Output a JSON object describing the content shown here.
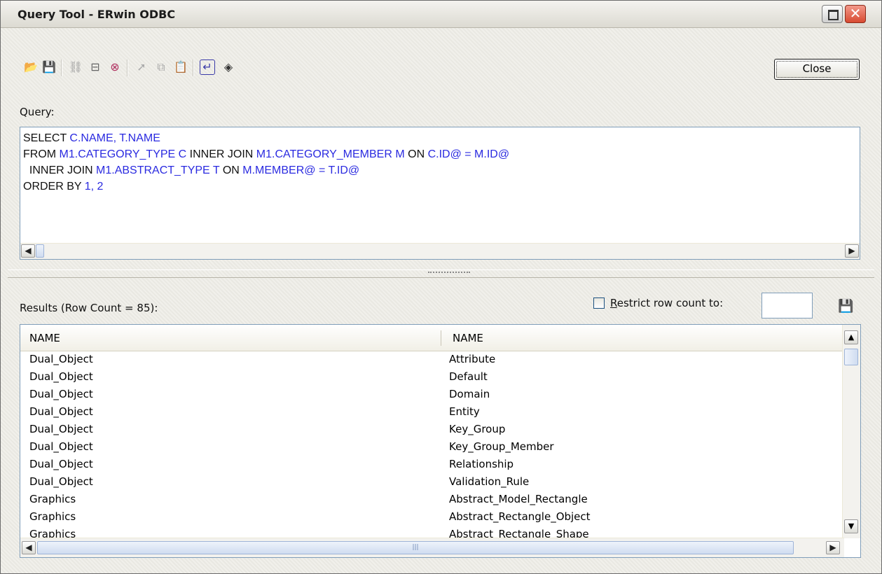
{
  "window": {
    "title": "Query Tool - ERwin ODBC"
  },
  "toolbar": {
    "close_label": "Close",
    "icons": [
      "open-icon",
      "save-icon",
      "link-icon",
      "tree-icon",
      "stop-icon",
      "run-icon",
      "copy-icon",
      "paste-icon",
      "enter-icon",
      "eraser-icon"
    ]
  },
  "query": {
    "label": "Query:",
    "lines": [
      [
        {
          "t": "SELECT ",
          "c": "kw"
        },
        {
          "t": "C.NAME, T.NAME",
          "c": "id"
        }
      ],
      [
        {
          "t": "FROM ",
          "c": "kw"
        },
        {
          "t": "M1.CATEGORY_TYPE C ",
          "c": "id"
        },
        {
          "t": "INNER JOIN ",
          "c": "kw"
        },
        {
          "t": "M1.CATEGORY_MEMBER M ",
          "c": "id"
        },
        {
          "t": "ON ",
          "c": "kw"
        },
        {
          "t": "C.ID@ = M.ID@",
          "c": "id"
        }
      ],
      [
        {
          "t": "  INNER JOIN ",
          "c": "kw"
        },
        {
          "t": "M1.ABSTRACT_TYPE T ",
          "c": "id"
        },
        {
          "t": "ON ",
          "c": "kw"
        },
        {
          "t": "M.MEMBER@ = T.ID@",
          "c": "id"
        }
      ],
      [
        {
          "t": "ORDER BY ",
          "c": "kw"
        },
        {
          "t": "1, 2",
          "c": "id"
        }
      ]
    ]
  },
  "results": {
    "label": "Results (Row Count = 85):",
    "restrict_label": "Restrict row count to:",
    "restrict_checked": false,
    "restrict_value": "",
    "columns": [
      "NAME",
      "NAME"
    ],
    "rows": [
      [
        "Dual_Object",
        "Attribute"
      ],
      [
        "Dual_Object",
        "Default"
      ],
      [
        "Dual_Object",
        "Domain"
      ],
      [
        "Dual_Object",
        "Entity"
      ],
      [
        "Dual_Object",
        "Key_Group"
      ],
      [
        "Dual_Object",
        "Key_Group_Member"
      ],
      [
        "Dual_Object",
        "Relationship"
      ],
      [
        "Dual_Object",
        "Validation_Rule"
      ],
      [
        "Graphics",
        "Abstract_Model_Rectangle"
      ],
      [
        "Graphics",
        "Abstract_Rectangle_Object"
      ],
      [
        "Graphics",
        "Abstract_Rectangle_Shape"
      ]
    ]
  },
  "colors": {
    "identifier": "#2a2ae0",
    "keyword": "#111111",
    "accent": "#7f9db9"
  }
}
